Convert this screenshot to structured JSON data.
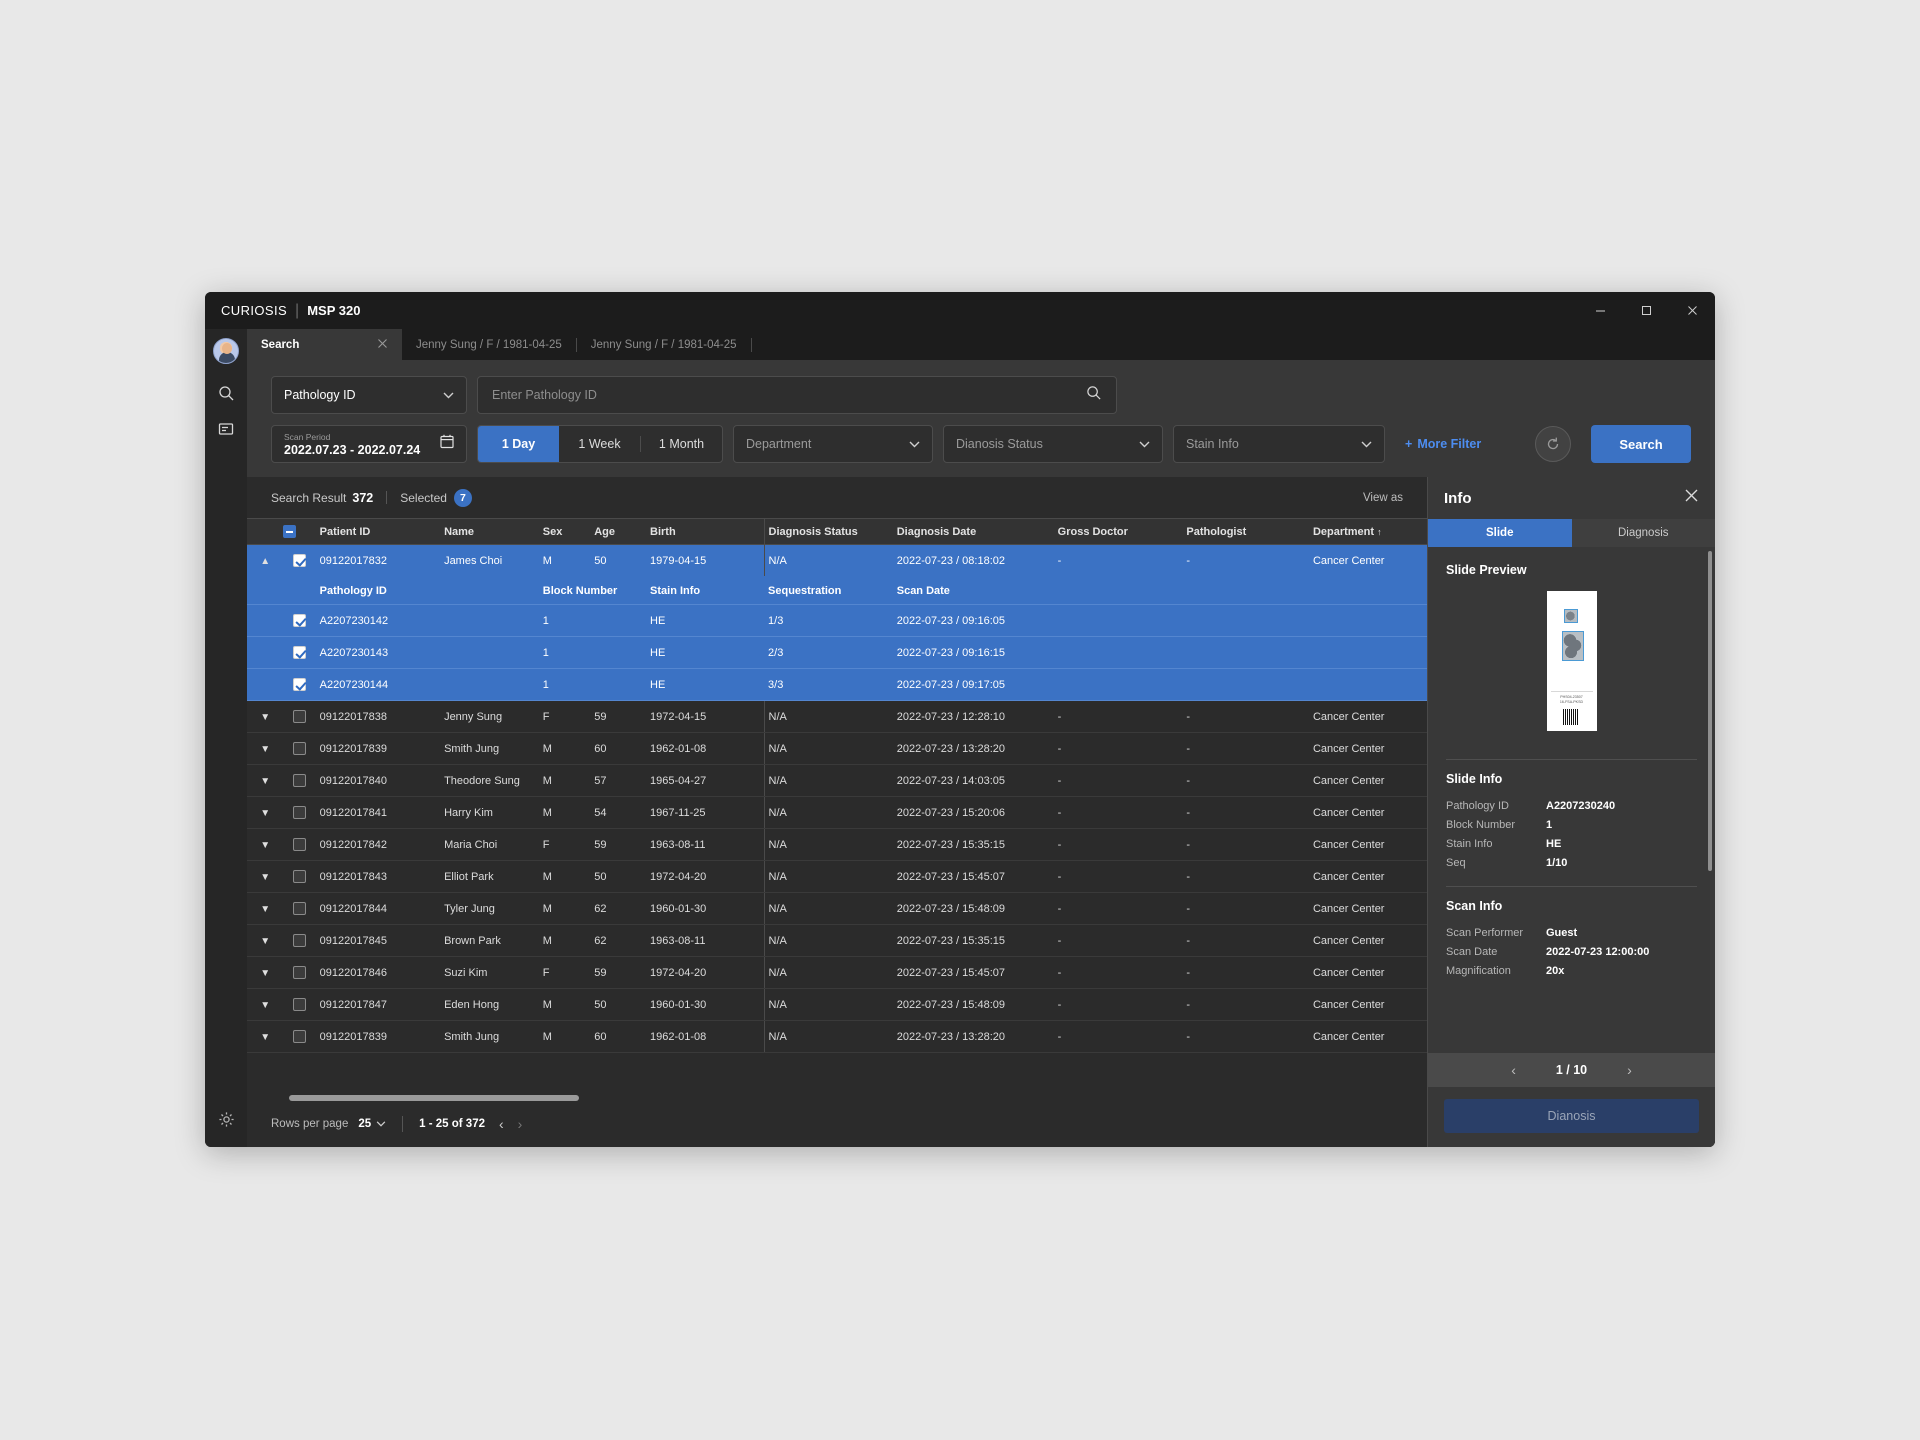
{
  "titlebar": {
    "brand": "CURIOSIS",
    "separator": "|",
    "model": "MSP 320",
    "minimize_label": "minimize",
    "maximize_label": "maximize",
    "close_label": "close"
  },
  "rail": {
    "avatar_label": "user-avatar",
    "items": [
      {
        "name": "search-icon",
        "label": "Search"
      },
      {
        "name": "report-icon",
        "label": "Report"
      }
    ],
    "bottom": {
      "name": "settings-icon",
      "label": "Settings"
    }
  },
  "tabs": [
    {
      "label": "Search",
      "active": true,
      "closable": true
    },
    {
      "label": "Jenny Sung / F / 1981-04-25",
      "active": false,
      "closable": false
    },
    {
      "label": "Jenny Sung / F / 1981-04-25",
      "active": false,
      "closable": false
    }
  ],
  "filters": {
    "category_select": {
      "value": "Pathology ID"
    },
    "search_input": {
      "placeholder": "Enter Pathology ID",
      "value": ""
    },
    "scan_period": {
      "label": "Scan Period",
      "value": "2022.07.23 - 2022.07.24"
    },
    "range_buttons": [
      {
        "label": "1 Day",
        "active": true
      },
      {
        "label": "1 Week",
        "active": false
      },
      {
        "label": "1 Month",
        "active": false
      }
    ],
    "department_select": {
      "value": "Department"
    },
    "diagnosis_select": {
      "value": "Dianosis Status"
    },
    "stain_select": {
      "value": "Stain Info"
    },
    "more_filter": "More Filter",
    "more_filter_plus": "+",
    "reset_label": "Reset",
    "search_button": "Search"
  },
  "result_bar": {
    "result_label": "Search Result",
    "result_count": "372",
    "selected_label": "Selected",
    "selected_count": "7",
    "view_as": "View as"
  },
  "table": {
    "columns": [
      "Patient ID",
      "Name",
      "Sex",
      "Age",
      "Birth",
      "Diagnosis Status",
      "Diagnosis Date",
      "Gross Doctor",
      "Pathologist",
      "Department"
    ],
    "department_sort": "↑",
    "sub_columns": [
      "Pathology ID",
      "Block Number",
      "Stain Info",
      "Sequestration",
      "Scan Date"
    ],
    "expanded_row": {
      "patient_id": "09122017832",
      "name": "James Choi",
      "sex": "M",
      "age": "50",
      "birth": "1979-04-15",
      "diagnosis_status": "N/A",
      "diagnosis_date": "2022-07-23 / 08:18:02",
      "gross_doctor": "-",
      "pathologist": "-",
      "department": "Cancer Center",
      "checked": true,
      "expanded": true
    },
    "sub_rows": [
      {
        "pathology_id": "A2207230142",
        "block_number": "1",
        "stain_info": "HE",
        "sequestration": "1/3",
        "scan_date": "2022-07-23 / 09:16:05",
        "checked": true
      },
      {
        "pathology_id": "A2207230143",
        "block_number": "1",
        "stain_info": "HE",
        "sequestration": "2/3",
        "scan_date": "2022-07-23 / 09:16:15",
        "checked": true
      },
      {
        "pathology_id": "A2207230144",
        "block_number": "1",
        "stain_info": "HE",
        "sequestration": "3/3",
        "scan_date": "2022-07-23 / 09:17:05",
        "checked": true
      }
    ],
    "rows": [
      {
        "patient_id": "09122017838",
        "name": "Jenny Sung",
        "sex": "F",
        "age": "59",
        "birth": "1972-04-15",
        "diagnosis_status": "N/A",
        "diagnosis_date": "2022-07-23 / 12:28:10",
        "gross_doctor": "-",
        "pathologist": "-",
        "department": "Cancer Center"
      },
      {
        "patient_id": "09122017839",
        "name": "Smith Jung",
        "sex": "M",
        "age": "60",
        "birth": "1962-01-08",
        "diagnosis_status": "N/A",
        "diagnosis_date": "2022-07-23 / 13:28:20",
        "gross_doctor": "-",
        "pathologist": "-",
        "department": "Cancer Center"
      },
      {
        "patient_id": "09122017840",
        "name": "Theodore Sung",
        "sex": "M",
        "age": "57",
        "birth": "1965-04-27",
        "diagnosis_status": "N/A",
        "diagnosis_date": "2022-07-23 / 14:03:05",
        "gross_doctor": "-",
        "pathologist": "-",
        "department": "Cancer Center"
      },
      {
        "patient_id": "09122017841",
        "name": "Harry Kim",
        "sex": "M",
        "age": "54",
        "birth": "1967-11-25",
        "diagnosis_status": "N/A",
        "diagnosis_date": "2022-07-23 / 15:20:06",
        "gross_doctor": "-",
        "pathologist": "-",
        "department": "Cancer Center"
      },
      {
        "patient_id": "09122017842",
        "name": "Maria Choi",
        "sex": "F",
        "age": "59",
        "birth": "1963-08-11",
        "diagnosis_status": "N/A",
        "diagnosis_date": "2022-07-23 / 15:35:15",
        "gross_doctor": "-",
        "pathologist": "-",
        "department": "Cancer Center"
      },
      {
        "patient_id": "09122017843",
        "name": "Elliot Park",
        "sex": "M",
        "age": "50",
        "birth": "1972-04-20",
        "diagnosis_status": "N/A",
        "diagnosis_date": "2022-07-23 / 15:45:07",
        "gross_doctor": "-",
        "pathologist": "-",
        "department": "Cancer Center"
      },
      {
        "patient_id": "09122017844",
        "name": "Tyler Jung",
        "sex": "M",
        "age": "62",
        "birth": "1960-01-30",
        "diagnosis_status": "N/A",
        "diagnosis_date": "2022-07-23 / 15:48:09",
        "gross_doctor": "-",
        "pathologist": "-",
        "department": "Cancer Center"
      },
      {
        "patient_id": "09122017845",
        "name": "Brown Park",
        "sex": "M",
        "age": "62",
        "birth": "1963-08-11",
        "diagnosis_status": "N/A",
        "diagnosis_date": "2022-07-23 / 15:35:15",
        "gross_doctor": "-",
        "pathologist": "-",
        "department": "Cancer Center"
      },
      {
        "patient_id": "09122017846",
        "name": "Suzi Kim",
        "sex": "F",
        "age": "59",
        "birth": "1972-04-20",
        "diagnosis_status": "N/A",
        "diagnosis_date": "2022-07-23 / 15:45:07",
        "gross_doctor": "-",
        "pathologist": "-",
        "department": "Cancer Center"
      },
      {
        "patient_id": "09122017847",
        "name": "Eden Hong",
        "sex": "M",
        "age": "50",
        "birth": "1960-01-30",
        "diagnosis_status": "N/A",
        "diagnosis_date": "2022-07-23 / 15:48:09",
        "gross_doctor": "-",
        "pathologist": "-",
        "department": "Cancer Center"
      },
      {
        "patient_id": "09122017839",
        "name": "Smith Jung",
        "sex": "M",
        "age": "60",
        "birth": "1962-01-08",
        "diagnosis_status": "N/A",
        "diagnosis_date": "2022-07-23 / 13:28:20",
        "gross_doctor": "-",
        "pathologist": "-",
        "department": "Cancer Center"
      }
    ]
  },
  "pagination": {
    "rows_per_page_label": "Rows per page",
    "rows_per_page_value": "25",
    "range": "1 - 25 of 372",
    "prev": "‹",
    "next": "›"
  },
  "info_panel": {
    "title": "Info",
    "close_label": "close",
    "tabs": [
      {
        "label": "Slide",
        "active": true
      },
      {
        "label": "Diagnosis",
        "active": false
      }
    ],
    "preview_title": "Slide Preview",
    "preview_label_line1": "PHS04-23507",
    "preview_label_line2": "16-FSA-PKSD",
    "slide_info": {
      "title": "Slide Info",
      "fields": [
        {
          "key": "Pathology ID",
          "value": "A2207230240"
        },
        {
          "key": "Block Number",
          "value": "1"
        },
        {
          "key": "Stain Info",
          "value": "HE"
        },
        {
          "key": "Seq",
          "value": "1/10"
        }
      ]
    },
    "scan_info": {
      "title": "Scan Info",
      "fields": [
        {
          "key": "Scan Performer",
          "value": "Guest"
        },
        {
          "key": "Scan Date",
          "value": "2022-07-23 12:00:00"
        },
        {
          "key": "Magnification",
          "value": "20x"
        }
      ]
    },
    "slide_pager": {
      "prev": "‹",
      "current": "1 / 10",
      "next": "›"
    },
    "diagnosis_button": "Dianosis"
  },
  "colors": {
    "accent": "#3b72c4",
    "window_bg": "#2b2b2b",
    "panel_bg": "#383838",
    "titlebar_bg": "#1c1c1c",
    "link": "#4d8df0",
    "diag_button": "#2a3f68"
  }
}
